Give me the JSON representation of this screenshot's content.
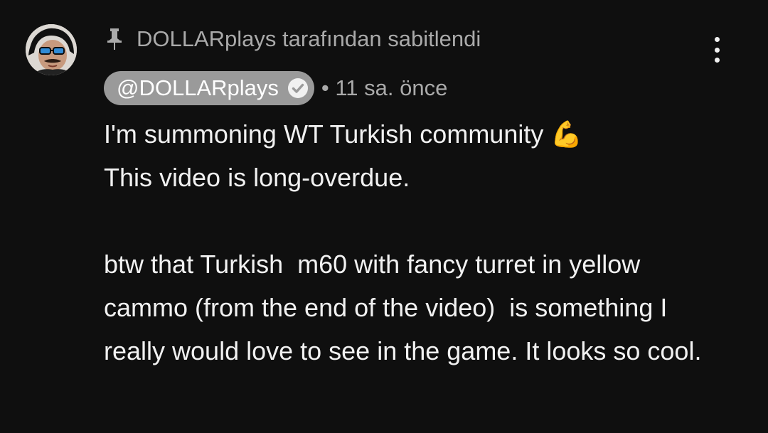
{
  "comment": {
    "pinned_label": "DOLLARplays tarafından sabitlendi",
    "author": "@DOLLARplays",
    "timestamp": "• 11 sa. önce",
    "text": "I'm summoning WT Turkish community 💪\nThis video is long-overdue.\n\nbtw that Turkish  m60 with fancy turret in yellow cammo (from the end of the video)  is something I really would love to see in the game. It looks so cool.",
    "icons": {
      "pin": "pin-icon",
      "verified": "verified-checkmark-icon",
      "menu": "more-vert-icon",
      "avatar": "avatar-image"
    },
    "colors": {
      "background": "#0f0f0f",
      "primary_text": "#f1f1f1",
      "secondary_text": "#aaaaaa",
      "author_chip": "#9a9a9a"
    }
  }
}
